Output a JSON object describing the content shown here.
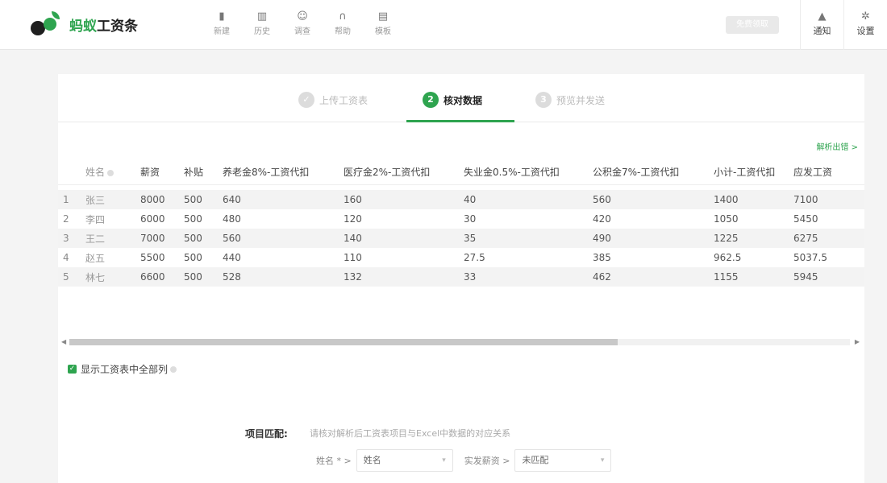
{
  "app": {
    "brand_green": "蚂蚁",
    "brand_dark": "工资条"
  },
  "nav": [
    {
      "label": "新建",
      "icon": "new-icon"
    },
    {
      "label": "历史",
      "icon": "history-icon"
    },
    {
      "label": "调查",
      "icon": "survey-icon"
    },
    {
      "label": "帮助",
      "icon": "help-icon"
    },
    {
      "label": "模板",
      "icon": "template-icon"
    }
  ],
  "header_right": {
    "wx_button": "免费领取",
    "notify": "通知",
    "settings": "设置"
  },
  "steps": [
    {
      "num": "✓",
      "label": "上传工资表",
      "active": false
    },
    {
      "num": "2",
      "label": "核对数据",
      "active": true
    },
    {
      "num": "3",
      "label": "预览并发送",
      "active": false
    }
  ],
  "parse_error_link": "解析出错 >",
  "table": {
    "headers": [
      "姓名",
      "薪资",
      "补贴",
      "养老金8%-工资代扣",
      "医疗金2%-工资代扣",
      "失业金0.5%-工资代扣",
      "公积金7%-工资代扣",
      "小计-工资代扣",
      "应发工资"
    ],
    "rows": [
      [
        "1",
        "张三",
        "8000",
        "500",
        "640",
        "160",
        "40",
        "560",
        "1400",
        "7100"
      ],
      [
        "2",
        "李四",
        "6000",
        "500",
        "480",
        "120",
        "30",
        "420",
        "1050",
        "5450"
      ],
      [
        "3",
        "王二",
        "7000",
        "500",
        "560",
        "140",
        "35",
        "490",
        "1225",
        "6275"
      ],
      [
        "4",
        "赵五",
        "5500",
        "500",
        "440",
        "110",
        "27.5",
        "385",
        "962.5",
        "5037.5"
      ],
      [
        "5",
        "林七",
        "6600",
        "500",
        "528",
        "132",
        "33",
        "462",
        "1155",
        "5945"
      ]
    ]
  },
  "show_all_columns": "显示工资表中全部列",
  "match": {
    "title": "项目匹配:",
    "hint": "请核对解析后工资表项目与Excel中数据的对应关系",
    "field1_label": "姓名 * >",
    "field1_value": "姓名",
    "field2_label": "实发薪资 >",
    "field2_value": "未匹配"
  }
}
